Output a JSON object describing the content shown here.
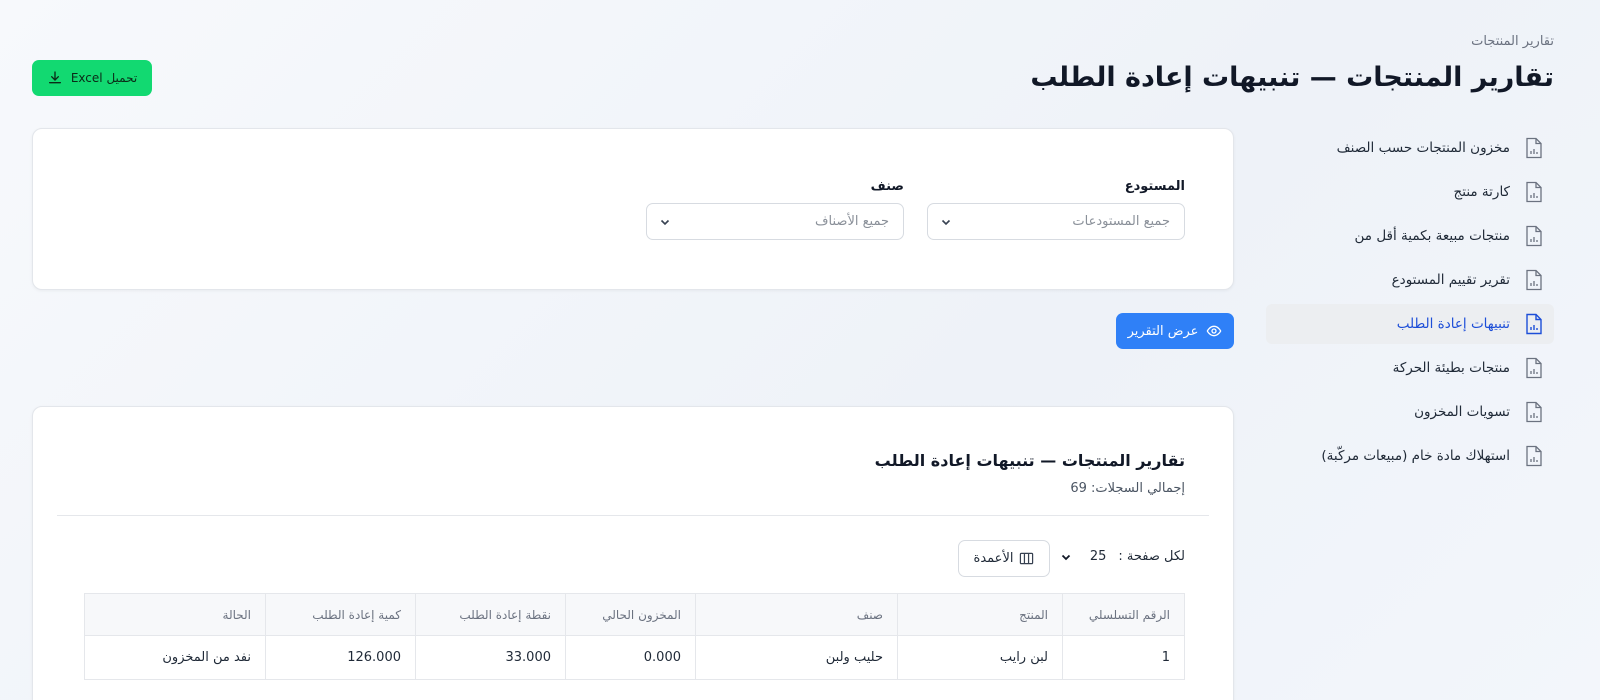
{
  "header": {
    "breadcrumb": "تقارير المنتجات",
    "title": "تقارير المنتجات — تنبيهات إعادة الطلب",
    "excel_button": "تحميل Excel"
  },
  "sidebar": {
    "items": [
      {
        "label": "مخزون المنتجات حسب الصنف",
        "active": false
      },
      {
        "label": "كارتة منتج",
        "active": false
      },
      {
        "label": "منتجات مبيعة بكمية أقل من",
        "active": false
      },
      {
        "label": "تقرير تقييم المستودع",
        "active": false
      },
      {
        "label": "تنبيهات إعادة الطلب",
        "active": true
      },
      {
        "label": "منتجات بطيئة الحركة",
        "active": false
      },
      {
        "label": "تسويات المخزون",
        "active": false
      },
      {
        "label": "استهلاك مادة خام (مبيعات مركّبة)",
        "active": false
      }
    ]
  },
  "filters": {
    "warehouse": {
      "label": "المستودع",
      "placeholder": "جميع المستودعات"
    },
    "category": {
      "label": "صنف",
      "placeholder": "جميع الأصناف"
    }
  },
  "view_button": "عرض التقرير",
  "report": {
    "title": "تقارير المنتجات — تنبيهات إعادة الطلب",
    "total": "إجمالي السجلات: 69",
    "per_page_label": "لكل صفحة :",
    "per_page_value": "25",
    "columns_button": "الأعمدة",
    "headers": [
      "الرقم التسلسلي",
      "المنتج",
      "صنف",
      "المخزون الحالي",
      "نقطة إعادة الطلب",
      "كمية إعادة الطلب",
      "الحالة"
    ],
    "rows": [
      [
        "1",
        "لبن رايب",
        "حليب ولبن",
        "0.000",
        "33.000",
        "126.000",
        "نفد من المخزون"
      ]
    ]
  },
  "colors": {
    "excel": "#12d971",
    "primary": "#2f80f7",
    "active_sidebar_text": "#1d4ed8"
  }
}
